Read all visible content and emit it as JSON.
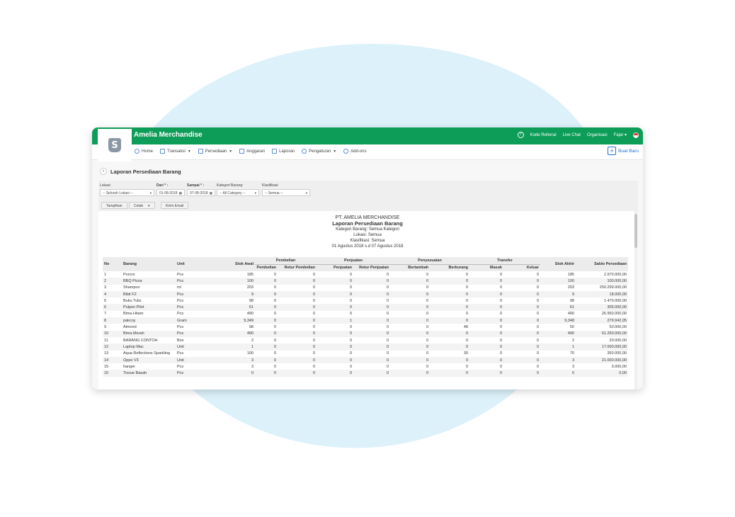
{
  "app": {
    "title": "Amelia Merchandise",
    "logo_letter": "S"
  },
  "topbar": {
    "help_icon": "?",
    "links": [
      "Kode Referral",
      "Live Chat",
      "Organisasi"
    ],
    "user": "Fajar"
  },
  "nav": {
    "items": [
      {
        "label": "Home",
        "icon": "home-icon",
        "caret": false
      },
      {
        "label": "Transaksi",
        "icon": "transaction-icon",
        "caret": true
      },
      {
        "label": "Persediaan",
        "icon": "inventory-icon",
        "caret": true
      },
      {
        "label": "Anggaran",
        "icon": "budget-icon",
        "caret": false
      },
      {
        "label": "Laporan",
        "icon": "report-icon",
        "caret": false
      },
      {
        "label": "Pengaturan",
        "icon": "settings-icon",
        "caret": true
      },
      {
        "label": "Add-ons",
        "icon": "addons-icon",
        "caret": false
      }
    ],
    "create_label": "Buat Baru"
  },
  "page": {
    "title": "Laporan Persediaan Barang"
  },
  "filters": {
    "lokasi_label": "Lokasi:",
    "lokasi_value": "-- Seluruh Lokasi --",
    "dari_label": "Dari * :",
    "dari_value": "01-08-2018",
    "sampai_label": "Sampai * :",
    "sampai_value": "07-08-2018",
    "kategori_label": "Kategori Barang:",
    "kategori_value": "-- All Category --",
    "klasifikasi_label": "Klasifikasi:",
    "klasifikasi_value": "-- Semua --",
    "btn_tampilkan": "Tampilkan",
    "btn_cetak": "Cetak",
    "btn_email": "Kirim Email"
  },
  "report": {
    "company": "PT. AMELIA MERCHANDISE",
    "title": "Laporan Persediaan Barang",
    "kategori": "Kategori Barang: Semua Kategori",
    "lokasi": "Lokasi: Semua",
    "klasifikasi": "Klasifikasi: Semua",
    "period": "01 Agustus 2018 s.d 07 Agustus 2018"
  },
  "table": {
    "h": {
      "no": "No",
      "barang": "Barang",
      "unit": "Unit",
      "stok_awal": "Stok Awal",
      "pembelian": "Pembelian",
      "penjualan": "Penjualan",
      "penyesuaian": "Penyesuaian",
      "transfer": "Transfer",
      "stok_akhir": "Stok Akhir",
      "saldo": "Saldo Persediaan",
      "pembelian_sub": "Pembelian",
      "retur_pembelian": "Retur Pembelian",
      "penjualan_sub": "Penjualan",
      "retur_penjualan": "Retur Penjualan",
      "bertambah": "Bertambah",
      "berkurang": "Berkurang",
      "masuk": "Masuk",
      "keluar": "Keluar"
    },
    "rows": [
      [
        "1",
        "Pororo",
        "Pcs",
        "185",
        "0",
        "0",
        "0",
        "0",
        "0",
        "0",
        "0",
        "0",
        "185",
        "2.970.000,00"
      ],
      [
        "2",
        "BBQ Pizza",
        "Pcs",
        "100",
        "0",
        "0",
        "0",
        "0",
        "0",
        "0",
        "0",
        "0",
        "100",
        "100.000,00"
      ],
      [
        "3",
        "Shampoo",
        "ml",
        "203",
        "0",
        "0",
        "0",
        "0",
        "0",
        "0",
        "0",
        "0",
        "203",
        "250.299.000,00"
      ],
      [
        "4",
        "Bibit F2",
        "Pcs",
        "9",
        "0",
        "0",
        "0",
        "0",
        "0",
        "0",
        "0",
        "0",
        "9",
        "18.000,00"
      ],
      [
        "5",
        "Buku Tulis",
        "Pcs",
        "98",
        "0",
        "0",
        "0",
        "0",
        "0",
        "0",
        "0",
        "0",
        "98",
        "1.470.000,00"
      ],
      [
        "6",
        "Pulpen Pilot",
        "Pcs",
        "61",
        "0",
        "0",
        "0",
        "0",
        "0",
        "0",
        "0",
        "0",
        "61",
        "305.000,00"
      ],
      [
        "7",
        "Bima Hitam",
        "Pcs",
        "490",
        "0",
        "0",
        "0",
        "0",
        "0",
        "0",
        "0",
        "0",
        "490",
        "26.950.000,00"
      ],
      [
        "8",
        "pakcoy",
        "Gram",
        "9,349",
        "0",
        "0",
        "1",
        "0",
        "0",
        "0",
        "0",
        "0",
        "9,348",
        "279.942,05"
      ],
      [
        "9",
        "Almond",
        "Pcs",
        "98",
        "0",
        "0",
        "0",
        "0",
        "0",
        "48",
        "0",
        "0",
        "50",
        "50.000,00"
      ],
      [
        "10",
        "Bima Merah",
        "Pcs",
        "490",
        "0",
        "0",
        "0",
        "0",
        "0",
        "0",
        "0",
        "0",
        "490",
        "61.250.000,00"
      ],
      [
        "11",
        "BARANG CONTOH",
        "Box",
        "2",
        "0",
        "0",
        "0",
        "0",
        "0",
        "0",
        "0",
        "0",
        "2",
        "20.000,00"
      ],
      [
        "12",
        "Laptop Mac",
        "Unit",
        "1",
        "0",
        "0",
        "0",
        "0",
        "0",
        "0",
        "0",
        "0",
        "1",
        "17.000.000,00"
      ],
      [
        "13",
        "Aqua Reflections Sparkling",
        "Pcs",
        "100",
        "0",
        "0",
        "0",
        "0",
        "0",
        "30",
        "0",
        "0",
        "70",
        "350.000,00"
      ],
      [
        "14",
        "Oppo V3",
        "Unit",
        "3",
        "0",
        "0",
        "0",
        "0",
        "0",
        "0",
        "0",
        "0",
        "3",
        "21.000.000,00"
      ],
      [
        "15",
        "hanger",
        "Pcs",
        "3",
        "0",
        "0",
        "0",
        "0",
        "0",
        "0",
        "0",
        "0",
        "3",
        "3.000,00"
      ],
      [
        "16",
        "Tissue Basah",
        "Pcs",
        "0",
        "0",
        "0",
        "0",
        "0",
        "0",
        "0",
        "0",
        "0",
        "0",
        "0,00"
      ]
    ]
  }
}
